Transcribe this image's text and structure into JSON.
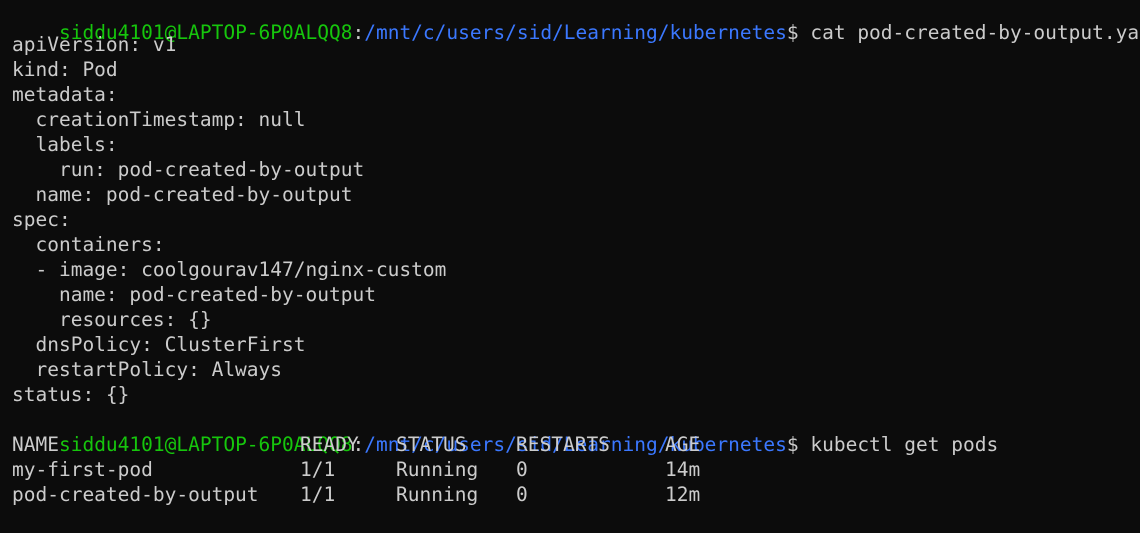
{
  "window": {
    "title": ""
  },
  "prompt": {
    "user_host": "siddu4101@LAPTOP-6P0ALQQ8",
    "sep": ":",
    "path": "/mnt/c/users/sid/Learning/kubernetes",
    "symbol": "$"
  },
  "commands": {
    "cat": "cat pod-created-by-output.yaml",
    "get_pods": "kubectl get pods",
    "current": ""
  },
  "yaml_output": [
    "apiVersion: v1",
    "kind: Pod",
    "metadata:",
    "  creationTimestamp: null",
    "  labels:",
    "    run: pod-created-by-output",
    "  name: pod-created-by-output",
    "spec:",
    "  containers:",
    "  - image: coolgourav147/nginx-custom",
    "    name: pod-created-by-output",
    "    resources: {}",
    "  dnsPolicy: ClusterFirst",
    "  restartPolicy: Always",
    "status: {}"
  ],
  "pods_table": {
    "headers": [
      "NAME",
      "READY",
      "STATUS",
      "RESTARTS",
      "AGE"
    ],
    "rows": [
      [
        "my-first-pod",
        "1/1",
        "Running",
        "0",
        "14m"
      ],
      [
        "pod-created-by-output",
        "1/1",
        "Running",
        "0",
        "12m"
      ]
    ]
  },
  "colors": {
    "background": "#0c0c0c",
    "text": "#cccccc",
    "user_host": "#16c60c",
    "path": "#3b78ff"
  }
}
